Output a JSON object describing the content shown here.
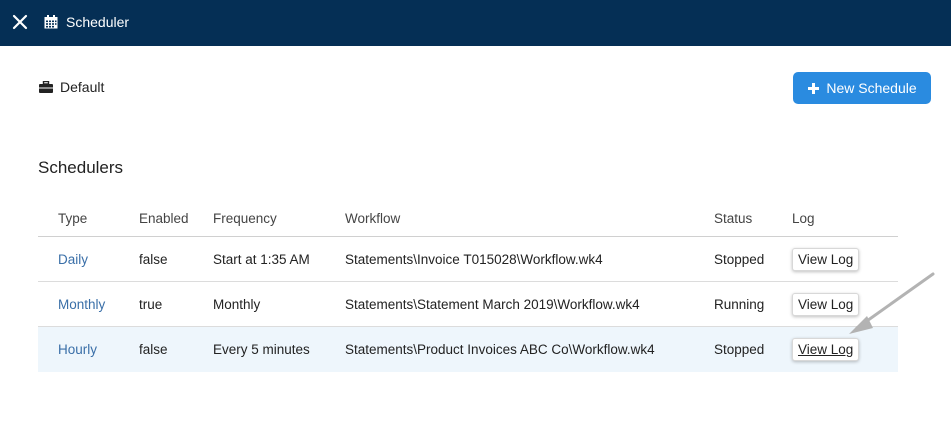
{
  "header": {
    "title": "Scheduler",
    "close_icon": "close-icon",
    "app_icon": "calendar-icon"
  },
  "context": {
    "label": "Default",
    "icon": "briefcase-icon"
  },
  "toolbar": {
    "new_schedule_label": "New Schedule",
    "accent_color": "#2a8be0"
  },
  "section": {
    "title": "Schedulers"
  },
  "table": {
    "columns": [
      "Type",
      "Enabled",
      "Frequency",
      "Workflow",
      "Status",
      "Log"
    ],
    "rows": [
      {
        "type": "Daily",
        "enabled": "false",
        "frequency": "Start at 1:35 AM",
        "workflow": "Statements\\Invoice T015028\\Workflow.wk4",
        "status": "Stopped",
        "log": "View Log"
      },
      {
        "type": "Monthly",
        "enabled": "true",
        "frequency": "Monthly",
        "workflow": "Statements\\Statement March 2019\\Workflow.wk4",
        "status": "Running",
        "log": "View Log"
      },
      {
        "type": "Hourly",
        "enabled": "false",
        "frequency": "Every 5 minutes",
        "workflow": "Statements\\Product Invoices ABC Co\\Workflow.wk4",
        "status": "Stopped",
        "log": "View Log"
      }
    ]
  },
  "colors": {
    "titlebar": "#052f55",
    "link": "#3a6fa8",
    "row_highlight": "#eef6fc"
  }
}
